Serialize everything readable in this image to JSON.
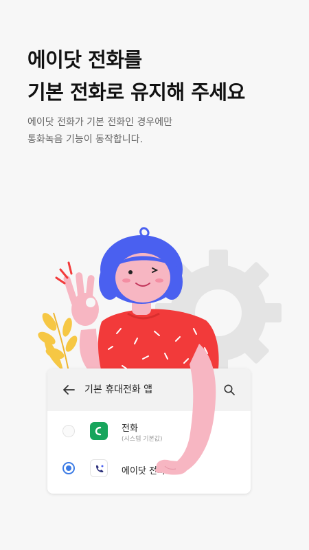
{
  "headline": {
    "line1": "에이닷 전화를",
    "line2": "기본 전화로 유지해 주세요"
  },
  "description": {
    "line1": "에이닷 전화가 기본 전화인 경우에만",
    "line2": "통화녹음 기능이 동작합니다."
  },
  "dialog": {
    "title": "기본 휴대전화 앱",
    "options": [
      {
        "name": "전화",
        "note": "(시스템 기본값)",
        "selected": false
      },
      {
        "name": "에이닷 전화",
        "note": "",
        "selected": true
      }
    ]
  },
  "colors": {
    "background": "#f7f7f7",
    "accent": "#3b7be5",
    "phone_app_green": "#17a55c",
    "shirt_red": "#f23a3a",
    "hair_blue": "#4a60f0",
    "skin_pink": "#f7b6c2"
  },
  "icons": [
    "back-arrow-icon",
    "search-icon",
    "phone-app-icon",
    "adot-phone-app-icon",
    "gear-icon"
  ]
}
